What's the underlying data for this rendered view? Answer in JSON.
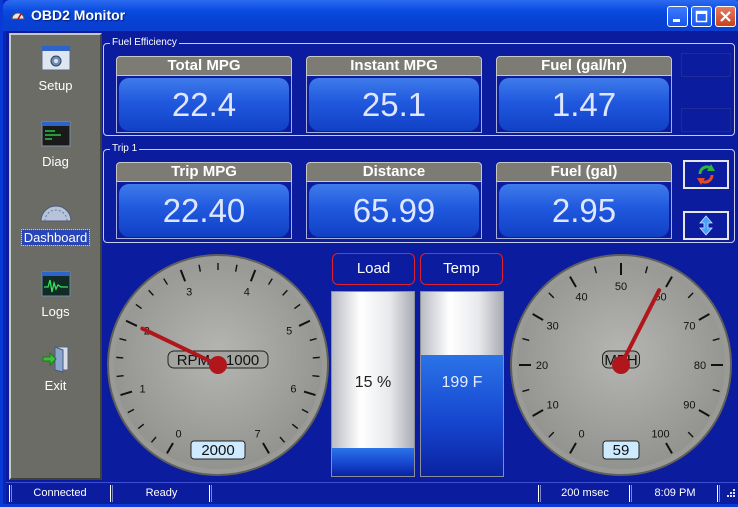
{
  "window": {
    "title": "OBD2 Monitor"
  },
  "sidebar": {
    "items": [
      {
        "label": "Setup",
        "icon": "setup-icon"
      },
      {
        "label": "Diag",
        "icon": "terminal-icon"
      },
      {
        "label": "Dashboard",
        "icon": "dashboard-gauge-icon",
        "active": true
      },
      {
        "label": "Logs",
        "icon": "waveform-icon"
      },
      {
        "label": "Exit",
        "icon": "exit-door-icon"
      }
    ]
  },
  "fuel_efficiency": {
    "legend": "Fuel Efficiency",
    "metrics": [
      {
        "label": "Total MPG",
        "value": "22.4"
      },
      {
        "label": "Instant MPG",
        "value": "25.1"
      },
      {
        "label": "Fuel (gal/hr)",
        "value": "1.47"
      }
    ]
  },
  "trip": {
    "legend": "Trip 1",
    "metrics": [
      {
        "label": "Trip MPG",
        "value": "22.40"
      },
      {
        "label": "Distance",
        "value": "65.99"
      },
      {
        "label": "Fuel (gal)",
        "value": "2.95"
      }
    ],
    "buttons": {
      "refresh_icon": "refresh-arrows-icon",
      "updown_icon": "up-down-arrow-icon"
    }
  },
  "rpm_gauge": {
    "label": "RPM x 1000",
    "ticks": [
      "0",
      "1",
      "2",
      "3",
      "4",
      "5",
      "6",
      "7"
    ],
    "readout": "2000",
    "value": 2000,
    "max": 7000
  },
  "load_bar": {
    "label": "Load",
    "text": "15 %",
    "fraction": 0.15
  },
  "temp_bar": {
    "label": "Temp",
    "text": "199 F",
    "fraction": 0.66
  },
  "speed_gauge": {
    "label": "MPH",
    "ticks": [
      "0",
      "10",
      "20",
      "30",
      "40",
      "50",
      "60",
      "70",
      "80",
      "90",
      "100"
    ],
    "readout": "59",
    "value": 59,
    "max": 100
  },
  "statusbar": {
    "connection": "Connected",
    "state": "Ready",
    "interval": "200 msec",
    "time": "8:09 PM"
  },
  "colors": {
    "accent_blue": "#0c1c9e",
    "needle_red": "#c2171b",
    "bar_border_red": "#e0202a"
  }
}
